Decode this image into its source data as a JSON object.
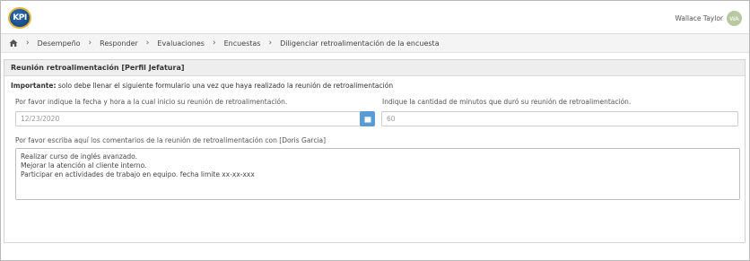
{
  "header": {
    "logo_text": "KPI",
    "user_name": "Wallace Taylor",
    "avatar_initials": "WA"
  },
  "breadcrumb": {
    "items": [
      "Desempeño",
      "Responder",
      "Evaluaciones",
      "Encuestas",
      "Diligenciar retroalimentación de la encuesta"
    ]
  },
  "panel": {
    "title": "Reunión retroalimentación [Perfil Jefatura]",
    "notice_strong": "Importante:",
    "notice_text": " solo debe llenar el siguiente formulario una vez que haya realizado la reunión de retroalimentación",
    "date_label": "Por favor indique la fecha y hora a la cual inicio su reunión de retroalimentación.",
    "date_value": "12/23/2020",
    "minutes_label": "Indique la cantidad de minutos que duró su reunión de retroalimentación.",
    "minutes_value": "60",
    "comments_label": "Por favor escriba aquí los comentarios de la reunión de retroalimentación con [Doris Garcia]",
    "comments_lines": [
      "Realizar curso de inglés avanzado.",
      "Mejorar la atención al cliente interno.",
      "Participar en actividades de trabajo en equipo. fecha limite xx-xx-xxx"
    ]
  },
  "colors": {
    "accent": "#5b9bd5",
    "avatar_bg": "#b9c7a2",
    "logo_bg": "#1b4f8c",
    "logo_ring": "#e0b53a"
  },
  "icons": {
    "home": "home-icon",
    "separator": "chevron-right-icon",
    "calendar": "calendar-icon"
  }
}
